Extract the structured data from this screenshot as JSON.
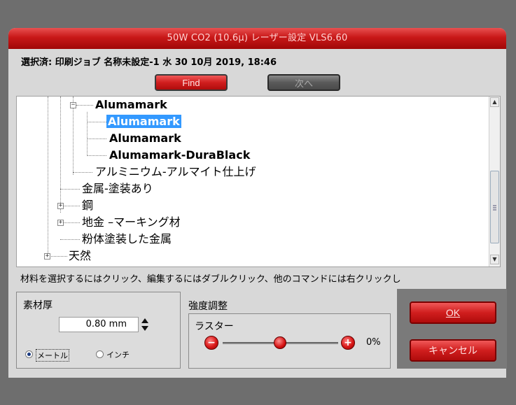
{
  "window": {
    "title": "50W CO2 (10.6µ) レーザー設定 VLS6.60"
  },
  "selection": {
    "text": "選択済: 印刷ジョブ 名称未設定-1 水 30 10月 2019, 18:46"
  },
  "buttons": {
    "find_label": "Find",
    "next_label": "次へ",
    "ok_label": "OK",
    "cancel_label": "キャンセル"
  },
  "tree": {
    "items": [
      {
        "label": "Alumamark",
        "level": 2,
        "expander": "minus",
        "bold": true
      },
      {
        "label": "Alumamark",
        "level": 3,
        "selected": true,
        "bold": true
      },
      {
        "label": "Alumamark",
        "level": 3,
        "bold": true
      },
      {
        "label": "Alumamark-DuraBlack",
        "level": 3,
        "bold": true
      },
      {
        "label": "アルミニウム-アルマイト仕上げ",
        "level": 2
      },
      {
        "label": "金属-塗装あり",
        "level": 1
      },
      {
        "label": "鋼",
        "level": 1,
        "expander": "plus"
      },
      {
        "label": "地金 –マーキング材",
        "level": 1,
        "expander": "plus"
      },
      {
        "label": "粉体塗装した金属",
        "level": 1
      },
      {
        "label": "天然",
        "level": 0,
        "expander": "plus"
      }
    ]
  },
  "hint": {
    "text": "材料を選択するにはクリック、編集するにはダブルクリック、他のコマンドには右クリックし"
  },
  "thickness": {
    "title": "素材厚",
    "value": "0.80 mm",
    "unit_metric": "メートル",
    "unit_inch": "インチ",
    "selected_unit": "メートル"
  },
  "intensity": {
    "title": "強度調整",
    "raster_label": "ラスター",
    "minus": "−",
    "plus": "+",
    "value_text": "0%",
    "value_percent": 0
  },
  "colors": {
    "title_red": "#c81818",
    "selection_blue": "#3399ff",
    "dialog_bg": "#d8d8d8",
    "outer_bg": "#6e6e6e"
  }
}
